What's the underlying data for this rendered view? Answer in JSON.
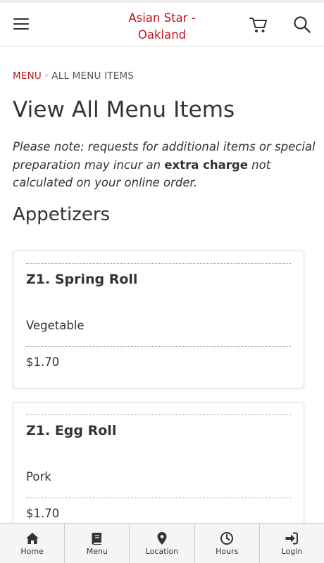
{
  "header": {
    "brand": "Asian Star - Oakland",
    "menu_icon": "hamburger-menu-icon",
    "cart_icon": "cart-icon",
    "search_icon": "search-icon"
  },
  "breadcrumb": {
    "link": "MENU",
    "separator": "»",
    "current": "ALL MENU ITEMS"
  },
  "page": {
    "title": "View All Menu Items",
    "note_before": "Please note: requests for additional items or special preparation may incur an ",
    "note_strong": "extra charge",
    "note_after": " not calculated on your online order."
  },
  "section": {
    "title": "Appetizers"
  },
  "items": [
    {
      "name": "Z1. Spring Roll",
      "description": "Vegetable",
      "price": "$1.70"
    },
    {
      "name": "Z1. Egg Roll",
      "description": "Pork",
      "price": "$1.70"
    }
  ],
  "bottom_nav": [
    {
      "label": "Home",
      "icon": "home-icon"
    },
    {
      "label": "Menu",
      "icon": "menu-book-icon"
    },
    {
      "label": "Location",
      "icon": "location-pin-icon"
    },
    {
      "label": "Hours",
      "icon": "clock-icon"
    },
    {
      "label": "Login",
      "icon": "login-icon"
    }
  ],
  "colors": {
    "brand": "#c0141e",
    "text": "#333333",
    "nav_bg": "#f5f5f5"
  }
}
